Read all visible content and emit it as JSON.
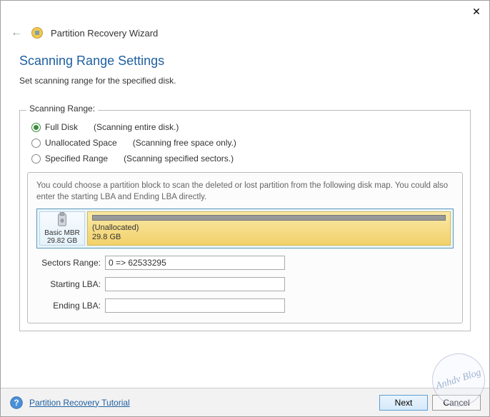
{
  "window": {
    "title": "Partition Recovery Wizard"
  },
  "page": {
    "heading": "Scanning Range Settings",
    "description": "Set scanning range for the specified disk."
  },
  "range": {
    "legend": "Scanning Range:",
    "options": [
      {
        "label": "Full Disk",
        "hint": "(Scanning entire disk.)",
        "selected": true
      },
      {
        "label": "Unallocated Space",
        "hint": "(Scanning free space only.)",
        "selected": false
      },
      {
        "label": "Specified Range",
        "hint": "(Scanning specified sectors.)",
        "selected": false
      }
    ]
  },
  "detail": {
    "description": "You could choose a partition block to scan the deleted or lost partition from the following disk map. You could also enter the starting LBA and Ending LBA directly.",
    "disk": {
      "type_label": "Basic MBR",
      "size_label": "29.82 GB",
      "block_name": "(Unallocated)",
      "block_size": "29.8 GB"
    },
    "fields": {
      "sectors_label": "Sectors Range:",
      "sectors_value": "0 => 62533295",
      "start_label": "Starting LBA:",
      "start_value": "",
      "end_label": "Ending LBA:",
      "end_value": ""
    }
  },
  "footer": {
    "tutorial": "Partition Recovery Tutorial",
    "next": "Next",
    "cancel": "Cancel"
  },
  "watermark": "Anhdv Blog"
}
